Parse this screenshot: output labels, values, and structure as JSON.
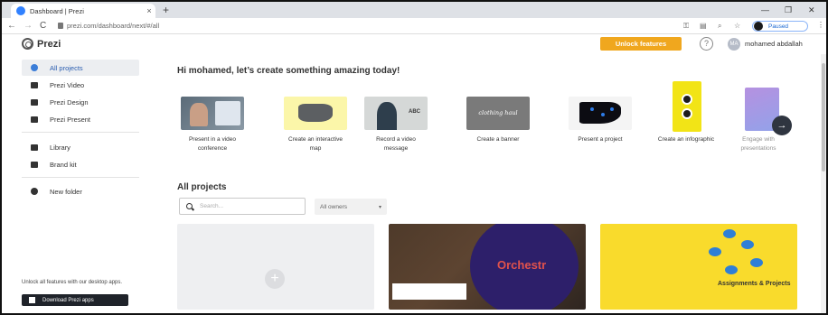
{
  "browser": {
    "tab_title": "Dashboard | Prezi",
    "tab_close": "×",
    "new_tab": "+",
    "url": "prezi.com/dashboard/next/#/all",
    "profile_label": "Paused",
    "controls": {
      "minimize": "—",
      "maximize": "❐",
      "close": "✕"
    },
    "nav": {
      "back": "←",
      "forward": "→",
      "reload": "C"
    }
  },
  "header": {
    "logo_text": "Prezi",
    "unlock_label": "Unlock features",
    "help_label": "?",
    "user_initials": "MA",
    "user_name": "mohamed abdallah"
  },
  "sidebar": {
    "items": [
      {
        "label": "All projects",
        "icon": "circle-icon"
      },
      {
        "label": "Prezi Video",
        "icon": "video-icon"
      },
      {
        "label": "Prezi Design",
        "icon": "design-icon"
      },
      {
        "label": "Prezi Present",
        "icon": "present-icon"
      },
      {
        "label": "Library",
        "icon": "library-icon"
      },
      {
        "label": "Brand kit",
        "icon": "brand-kit-icon"
      },
      {
        "label": "New folder",
        "icon": "plus-circle-icon"
      }
    ],
    "desktop_message": "Unlock all features with our desktop apps.",
    "download_label": "Download Prezi apps"
  },
  "main": {
    "greeting": "Hi mohamed, let’s create something amazing today!",
    "templates": [
      {
        "label": "Present in a video conference"
      },
      {
        "label": "Create an interactive map"
      },
      {
        "label": "Record a video message"
      },
      {
        "label": "Create a banner",
        "thumb_text": "clothing haul"
      },
      {
        "label": "Present a project"
      },
      {
        "label": "Create an infographic"
      },
      {
        "label": "Engage with presentations"
      }
    ],
    "record_thumb_text": "ABC",
    "arrow_label": "→",
    "all_projects_title": "All projects",
    "search_placeholder": "Search...",
    "owners_label": "All owners",
    "projects": [
      {
        "title": "Orchestr"
      },
      {
        "title": "Assignments & Projects"
      }
    ],
    "new_project_plus": "+"
  },
  "colors": {
    "accent": "#f0a71e",
    "active_nav_text": "#2a5db0",
    "banner_dark": "#1f232a"
  }
}
